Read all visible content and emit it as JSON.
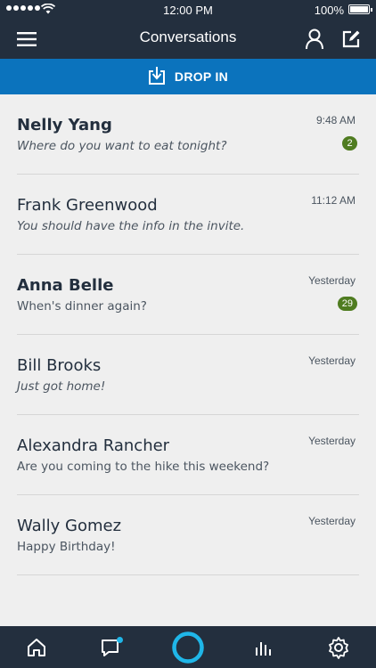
{
  "status_bar": {
    "time": "12:00 PM",
    "battery": "100%"
  },
  "nav": {
    "title": "Conversations",
    "icons": {
      "menu": "hamburger-menu-icon",
      "contacts": "person-icon",
      "compose": "compose-icon"
    }
  },
  "drop_in": {
    "label": "DROP IN",
    "icon": "drop-in-icon"
  },
  "conversations": [
    {
      "name": "Nelly Yang",
      "preview": "Where do you want to eat tonight?",
      "time": "9:48 AM",
      "badge": "2",
      "unread": true,
      "italic": true
    },
    {
      "name": "Frank Greenwood",
      "preview": "You should have the info in the invite.",
      "time": "11:12 AM",
      "badge": "",
      "unread": false,
      "italic": true
    },
    {
      "name": "Anna Belle",
      "preview": "When's dinner again?",
      "time": "Yesterday",
      "badge": "29",
      "unread": true,
      "italic": false
    },
    {
      "name": "Bill Brooks",
      "preview": "Just got home!",
      "time": "Yesterday",
      "badge": "",
      "unread": false,
      "italic": true
    },
    {
      "name": "Alexandra Rancher",
      "preview": "Are you coming to the hike this weekend?",
      "time": "Yesterday",
      "badge": "",
      "unread": false,
      "italic": false
    },
    {
      "name": "Wally Gomez",
      "preview": "Happy Birthday!",
      "time": "Yesterday",
      "badge": "",
      "unread": false,
      "italic": false
    }
  ],
  "tabs": [
    "home-icon",
    "chat-icon",
    "alexa-icon",
    "activity-icon",
    "settings-icon"
  ],
  "colors": {
    "header": "#232f3e",
    "drop_in": "#0b73bd",
    "badge": "#4f7c20",
    "accent": "#1fb6e8"
  }
}
